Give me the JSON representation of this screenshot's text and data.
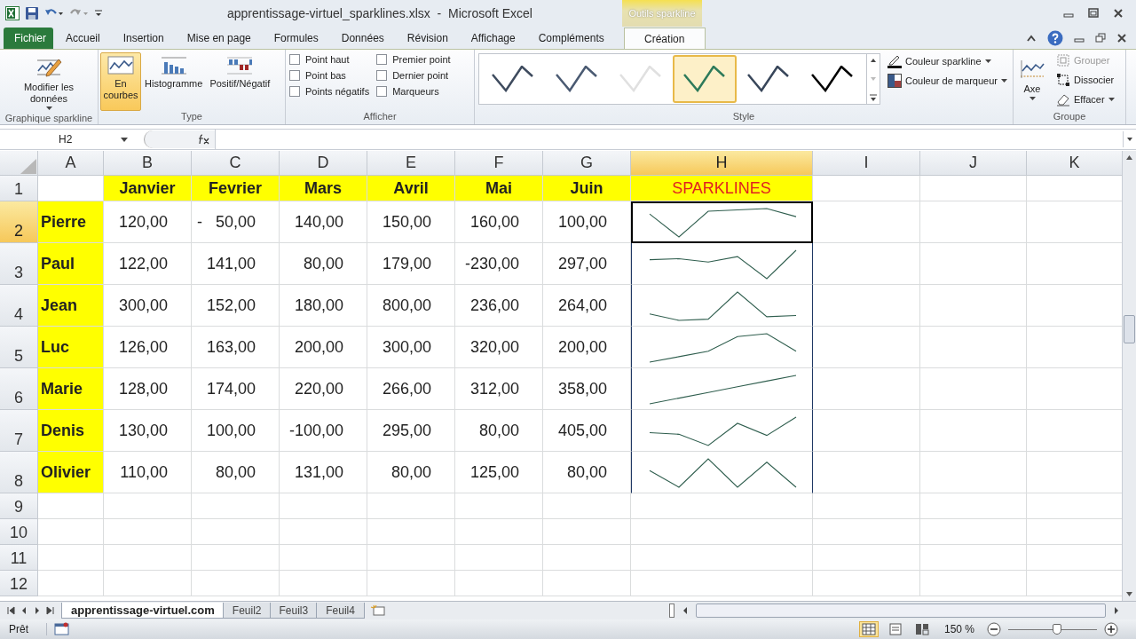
{
  "title_bar": {
    "title": "apprentissage-virtuel_sparklines.xlsx  -  Microsoft Excel",
    "contextual_label": "Outils sparkline"
  },
  "tabs": [
    {
      "label": "Fichier",
      "kind": "file",
      "selected": false
    },
    {
      "label": "Accueil",
      "kind": "normal",
      "selected": false
    },
    {
      "label": "Insertion",
      "kind": "normal",
      "selected": false
    },
    {
      "label": "Mise en page",
      "kind": "normal",
      "selected": false
    },
    {
      "label": "Formules",
      "kind": "normal",
      "selected": false
    },
    {
      "label": "Données",
      "kind": "normal",
      "selected": false
    },
    {
      "label": "Révision",
      "kind": "normal",
      "selected": false
    },
    {
      "label": "Affichage",
      "kind": "normal",
      "selected": false
    },
    {
      "label": "Compléments",
      "kind": "normal",
      "selected": false
    },
    {
      "label": "Création",
      "kind": "contextual",
      "selected": true
    }
  ],
  "ribbon": {
    "data_group": {
      "label": "Graphique sparkline",
      "button": "Modifier les données"
    },
    "type_group": {
      "label": "Type",
      "buttons": [
        {
          "label": "En courbes",
          "kind": "line",
          "selected": true
        },
        {
          "label": "Histogramme",
          "kind": "column",
          "selected": false
        },
        {
          "label": "Positif/Négatif",
          "kind": "winloss",
          "selected": false
        }
      ]
    },
    "show_group": {
      "label": "Afficher",
      "checkboxes": [
        {
          "label": "Point haut",
          "checked": false
        },
        {
          "label": "Point bas",
          "checked": false
        },
        {
          "label": "Points négatifs",
          "checked": false
        },
        {
          "label": "Premier point",
          "checked": false
        },
        {
          "label": "Dernier point",
          "checked": false
        },
        {
          "label": "Marqueurs",
          "checked": false
        }
      ]
    },
    "style_group": {
      "label": "Style",
      "styles": [
        {
          "color": "#3e4b5e",
          "selected": false
        },
        {
          "color": "#4a5a72",
          "selected": false
        },
        {
          "color": "#e0e0e0",
          "selected": false
        },
        {
          "color": "#2d7a5a",
          "selected": true
        },
        {
          "color": "#38465a",
          "selected": false
        },
        {
          "color": "#000000",
          "selected": false
        }
      ],
      "commands": [
        "Couleur sparkline",
        "Couleur de marqueur"
      ]
    },
    "group_group": {
      "label": "Groupe",
      "axis": "Axe",
      "commands": [
        {
          "label": "Grouper",
          "disabled": true
        },
        {
          "label": "Dissocier",
          "disabled": false
        },
        {
          "label": "Effacer",
          "disabled": false
        }
      ]
    }
  },
  "formula_bar": {
    "name_box": "H2"
  },
  "columns": [
    {
      "label": "A",
      "selected": false
    },
    {
      "label": "B",
      "selected": false
    },
    {
      "label": "C",
      "selected": false
    },
    {
      "label": "D",
      "selected": false
    },
    {
      "label": "E",
      "selected": false
    },
    {
      "label": "F",
      "selected": false
    },
    {
      "label": "G",
      "selected": false
    },
    {
      "label": "H",
      "selected": true
    },
    {
      "label": "I",
      "selected": false
    },
    {
      "label": "J",
      "selected": false
    },
    {
      "label": "K",
      "selected": false
    }
  ],
  "rows": [
    {
      "number": "1",
      "kind": "header",
      "selected": false,
      "cells": [
        "Janvier",
        "Fevrier",
        "Mars",
        "Avril",
        "Mai",
        "Juin",
        "SPARKLINES"
      ]
    },
    {
      "number": "2",
      "kind": "data",
      "selected": true,
      "name": "Pierre",
      "cells": [
        "120,00",
        "-   50,00",
        "140,00",
        "150,00",
        "160,00",
        "100,00"
      ]
    },
    {
      "number": "3",
      "kind": "data",
      "selected": false,
      "name": "Paul",
      "cells": [
        "122,00",
        "141,00",
        "80,00",
        "179,00",
        "-230,00",
        "297,00"
      ]
    },
    {
      "number": "4",
      "kind": "data",
      "selected": false,
      "name": "Jean",
      "cells": [
        "300,00",
        "152,00",
        "180,00",
        "800,00",
        "236,00",
        "264,00"
      ]
    },
    {
      "number": "5",
      "kind": "data",
      "selected": false,
      "name": "Luc",
      "cells": [
        "126,00",
        "163,00",
        "200,00",
        "300,00",
        "320,00",
        "200,00"
      ]
    },
    {
      "number": "6",
      "kind": "data",
      "selected": false,
      "name": "Marie",
      "cells": [
        "128,00",
        "174,00",
        "220,00",
        "266,00",
        "312,00",
        "358,00"
      ]
    },
    {
      "number": "7",
      "kind": "data",
      "selected": false,
      "name": "Denis",
      "cells": [
        "130,00",
        "100,00",
        "-100,00",
        "295,00",
        "80,00",
        "405,00"
      ]
    },
    {
      "number": "8",
      "kind": "data",
      "selected": false,
      "name": "Olivier",
      "cells": [
        "110,00",
        "80,00",
        "131,00",
        "80,00",
        "125,00",
        "80,00"
      ]
    },
    {
      "number": "9",
      "kind": "empty",
      "selected": false
    },
    {
      "number": "10",
      "kind": "empty",
      "selected": false
    },
    {
      "number": "11",
      "kind": "empty",
      "selected": false
    },
    {
      "number": "12",
      "kind": "empty",
      "selected": false
    }
  ],
  "sheet_tabs": [
    {
      "label": "apprentissage-virtuel.com",
      "selected": true
    },
    {
      "label": "Feuil2",
      "selected": false
    },
    {
      "label": "Feuil3",
      "selected": false
    },
    {
      "label": "Feuil4",
      "selected": false
    }
  ],
  "status_bar": {
    "status": "Prêt",
    "zoom": "150 %",
    "zoom_slider": {
      "level": 0.55
    }
  }
}
